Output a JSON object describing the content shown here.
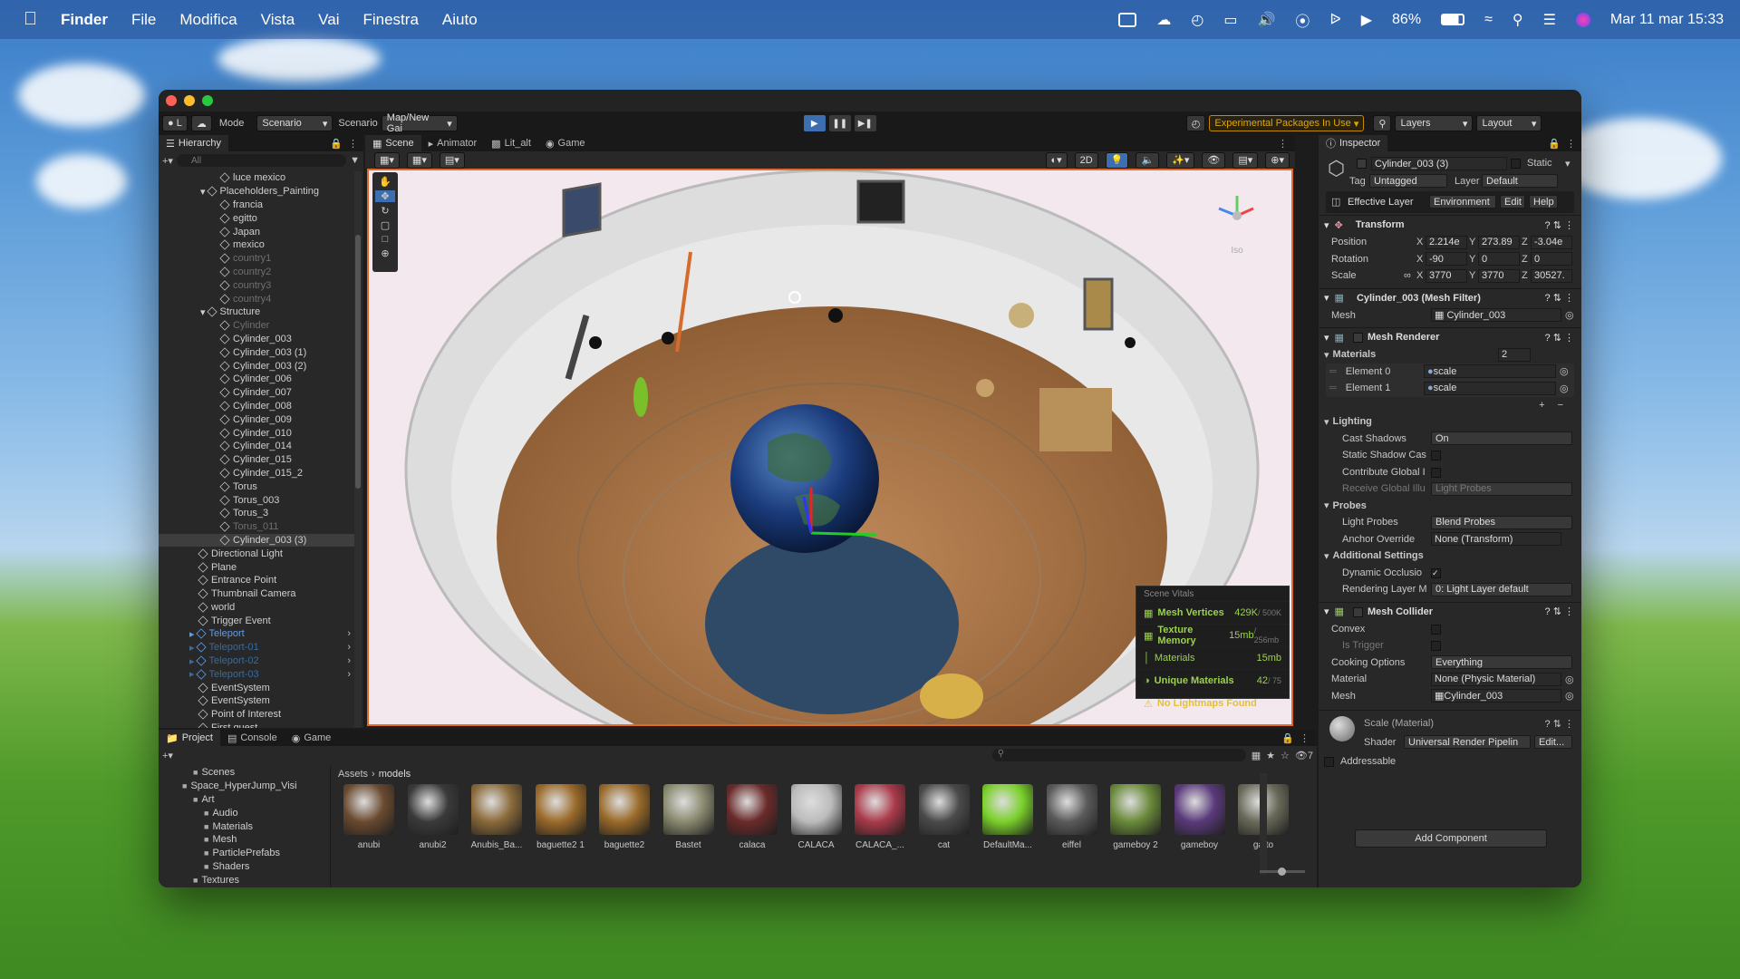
{
  "menubar": {
    "app": "Finder",
    "items": [
      "File",
      "Modifica",
      "Vista",
      "Vai",
      "Finestra",
      "Aiuto"
    ],
    "battery": "86%",
    "datetime": "Mar 11 mar  15:33"
  },
  "toolbar": {
    "account_label": "L",
    "mode_label": "Mode",
    "mode_value": "Scenario",
    "scenario_label": "Scenario",
    "scenario_value": "Map/New Gai",
    "experimental": "Experimental Packages In Use",
    "layers": "Layers",
    "layout": "Layout"
  },
  "hierarchy": {
    "tab": "Hierarchy",
    "search_placeholder": "All",
    "items": [
      {
        "label": "luce mexico",
        "indent": 2,
        "style": ""
      },
      {
        "label": "Placeholders_Painting",
        "indent": 1,
        "style": ""
      },
      {
        "label": "francia",
        "indent": 2,
        "style": ""
      },
      {
        "label": "egitto",
        "indent": 2,
        "style": ""
      },
      {
        "label": "Japan",
        "indent": 2,
        "style": ""
      },
      {
        "label": "mexico",
        "indent": 2,
        "style": ""
      },
      {
        "label": "country1",
        "indent": 2,
        "style": "dim"
      },
      {
        "label": "country2",
        "indent": 2,
        "style": "dim"
      },
      {
        "label": "country3",
        "indent": 2,
        "style": "dim"
      },
      {
        "label": "country4",
        "indent": 2,
        "style": "dim"
      },
      {
        "label": "Structure",
        "indent": 1,
        "style": ""
      },
      {
        "label": "Cylinder",
        "indent": 2,
        "style": "dim"
      },
      {
        "label": "Cylinder_003",
        "indent": 2,
        "style": ""
      },
      {
        "label": "Cylinder_003 (1)",
        "indent": 2,
        "style": ""
      },
      {
        "label": "Cylinder_003 (2)",
        "indent": 2,
        "style": ""
      },
      {
        "label": "Cylinder_006",
        "indent": 2,
        "style": ""
      },
      {
        "label": "Cylinder_007",
        "indent": 2,
        "style": ""
      },
      {
        "label": "Cylinder_008",
        "indent": 2,
        "style": ""
      },
      {
        "label": "Cylinder_009",
        "indent": 2,
        "style": ""
      },
      {
        "label": "Cylinder_010",
        "indent": 2,
        "style": ""
      },
      {
        "label": "Cylinder_014",
        "indent": 2,
        "style": ""
      },
      {
        "label": "Cylinder_015",
        "indent": 2,
        "style": ""
      },
      {
        "label": "Cylinder_015_2",
        "indent": 2,
        "style": ""
      },
      {
        "label": "Torus",
        "indent": 2,
        "style": ""
      },
      {
        "label": "Torus_003",
        "indent": 2,
        "style": ""
      },
      {
        "label": "Torus_3",
        "indent": 2,
        "style": ""
      },
      {
        "label": "Torus_011",
        "indent": 2,
        "style": "dim"
      },
      {
        "label": "Cylinder_003 (3)",
        "indent": 2,
        "style": "sel"
      },
      {
        "label": "Directional Light",
        "indent": 0,
        "style": ""
      },
      {
        "label": "Plane",
        "indent": 0,
        "style": ""
      },
      {
        "label": "Entrance Point",
        "indent": 0,
        "style": ""
      },
      {
        "label": "Thumbnail Camera",
        "indent": 0,
        "style": ""
      },
      {
        "label": "world",
        "indent": 0,
        "style": ""
      },
      {
        "label": "Trigger Event",
        "indent": 0,
        "style": ""
      },
      {
        "label": "Teleport",
        "indent": 0,
        "style": "blue"
      },
      {
        "label": "Teleport-01",
        "indent": 0,
        "style": "blued"
      },
      {
        "label": "Teleport-02",
        "indent": 0,
        "style": "blued"
      },
      {
        "label": "Teleport-03",
        "indent": 0,
        "style": "blued"
      },
      {
        "label": "EventSystem",
        "indent": 0,
        "style": ""
      },
      {
        "label": "EventSystem",
        "indent": 0,
        "style": ""
      },
      {
        "label": "Point of Interest",
        "indent": 0,
        "style": ""
      },
      {
        "label": "First quest",
        "indent": 0,
        "style": ""
      }
    ]
  },
  "scene": {
    "tabs": [
      "Scene",
      "Animator",
      "Lit_alt",
      "Game"
    ],
    "mode_2d": "2D",
    "iso": "Iso"
  },
  "vitals": {
    "title": "Scene Vitals",
    "rows": [
      {
        "label": "Mesh Vertices",
        "value": "429K",
        "max": " / 500K"
      },
      {
        "label": "Texture Memory",
        "value": "15mb",
        "max": " / 256mb"
      },
      {
        "label": "Materials",
        "value": "15mb",
        "max": ""
      },
      {
        "label": "Unique Materials",
        "value": "42",
        "max": " / 75"
      },
      {
        "label": "No Lightmaps Found",
        "value": "",
        "max": ""
      }
    ]
  },
  "inspector": {
    "tab": "Inspector",
    "object_name": "Cylinder_003 (3)",
    "static": "Static",
    "tag_label": "Tag",
    "tag": "Untagged",
    "layer_label": "Layer",
    "layer": "Default",
    "effective_layer": "Effective Layer",
    "effective_value": "Environment",
    "edit": "Edit",
    "help": "Help",
    "transform": {
      "title": "Transform",
      "position_label": "Position",
      "rotation_label": "Rotation",
      "scale_label": "Scale",
      "position": [
        "2.214e",
        "273.89",
        "-3.04e"
      ],
      "rotation": [
        "-90",
        "0",
        "0"
      ],
      "scale": [
        "3770",
        "3770",
        "30527."
      ],
      "x": "X",
      "y": "Y",
      "z": "Z"
    },
    "mesh_filter": {
      "title": "Cylinder_003 (Mesh Filter)",
      "mesh_label": "Mesh",
      "mesh": "Cylinder_003"
    },
    "mesh_renderer": {
      "title": "Mesh Renderer",
      "materials_label": "Materials",
      "materials_count": "2",
      "elements": [
        {
          "label": "Element 0",
          "value": "scale"
        },
        {
          "label": "Element 1",
          "value": "scale"
        }
      ],
      "lighting": "Lighting",
      "cast_shadows_label": "Cast Shadows",
      "cast_shadows": "On",
      "static_shadow_label": "Static Shadow Cas",
      "contribute_label": "Contribute Global I",
      "receive_label": "Receive Global Illu",
      "receive": "Light Probes",
      "probes": "Probes",
      "light_probes_label": "Light Probes",
      "light_probes": "Blend Probes",
      "anchor_label": "Anchor Override",
      "anchor": "None (Transform)",
      "additional": "Additional Settings",
      "dynamic_label": "Dynamic Occlusio",
      "rendering_label": "Rendering Layer M",
      "rendering": "0: Light Layer default"
    },
    "mesh_collider": {
      "title": "Mesh Collider",
      "convex_label": "Convex",
      "trigger_label": "Is Trigger",
      "cooking_label": "Cooking Options",
      "cooking": "Everything",
      "material_label": "Material",
      "material": "None (Physic Material)",
      "mesh_label": "Mesh",
      "mesh": "Cylinder_003"
    },
    "material_name": "Scale (Material)",
    "shader_label": "Shader",
    "shader": "Universal Render Pipelin",
    "shader_edit": "Edit...",
    "addressable": "Addressable",
    "add_component": "Add Component"
  },
  "project": {
    "tabs": [
      "Project",
      "Console",
      "Game"
    ],
    "breadcrumb": [
      "Assets",
      "models"
    ],
    "tree": [
      {
        "label": "Scenes",
        "indent": 1
      },
      {
        "label": "Space_HyperJump_Visi",
        "indent": 0
      },
      {
        "label": "Art",
        "indent": 1
      },
      {
        "label": "Audio",
        "indent": 2
      },
      {
        "label": "Materials",
        "indent": 2
      },
      {
        "label": "Mesh",
        "indent": 2
      },
      {
        "label": "ParticlePrefabs",
        "indent": 2
      },
      {
        "label": "Shaders",
        "indent": 2
      },
      {
        "label": "Textures",
        "indent": 1
      }
    ],
    "hidden_count": "7",
    "assets": [
      {
        "label": "anubi",
        "color": "#6a4a30"
      },
      {
        "label": "anubi2",
        "color": "#3a3a3a"
      },
      {
        "label": "Anubis_Ba...",
        "color": "#8a6a3a"
      },
      {
        "label": "baguette2 1",
        "color": "#9a6a2a"
      },
      {
        "label": "baguette2",
        "color": "#9a6a2a"
      },
      {
        "label": "Bastet",
        "color": "#8a8a70"
      },
      {
        "label": "calaca",
        "color": "#6a2a2a"
      },
      {
        "label": "CALACA",
        "color": "#bbbbbb"
      },
      {
        "label": "CALACA_...",
        "color": "#aa3a4a"
      },
      {
        "label": "cat",
        "color": "#4a4a4a"
      },
      {
        "label": "DefaultMa...",
        "color": "#7ad02a"
      },
      {
        "label": "eiffel",
        "color": "#5a5a5a"
      },
      {
        "label": "gameboy 2",
        "color": "#6a8a3a"
      },
      {
        "label": "gameboy",
        "color": "#5a3a7a"
      },
      {
        "label": "gatto",
        "color": "#6a6a5a"
      }
    ]
  }
}
